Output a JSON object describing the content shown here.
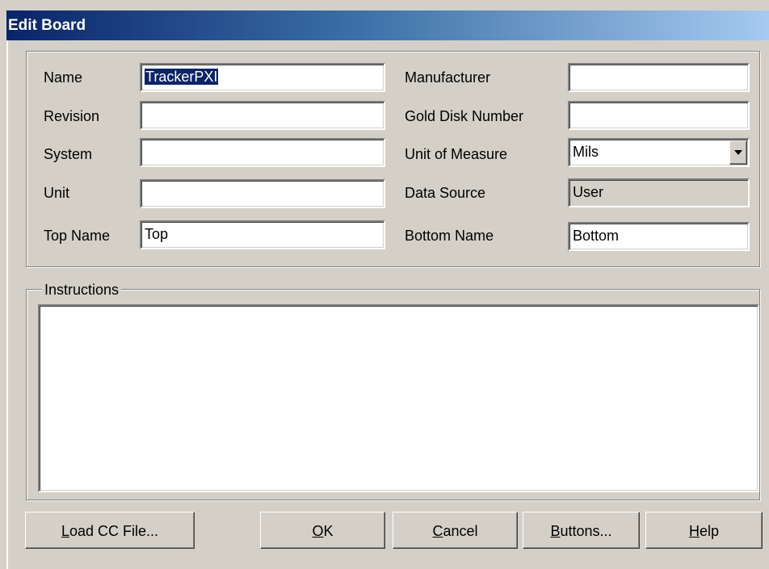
{
  "window": {
    "title": "Edit Board"
  },
  "fields": {
    "name": {
      "label": "Name",
      "value_selected": "TrackerPXI"
    },
    "revision": {
      "label": "Revision",
      "value": ""
    },
    "system": {
      "label": "System",
      "value": ""
    },
    "unit": {
      "label": "Unit",
      "value": ""
    },
    "top_name": {
      "label": "Top Name",
      "value": "Top"
    },
    "manufacturer": {
      "label": "Manufacturer",
      "value": ""
    },
    "gold_disk_number": {
      "label": "Gold Disk Number",
      "value": ""
    },
    "unit_of_measure": {
      "label": "Unit of Measure",
      "value": "Mils"
    },
    "data_source": {
      "label": "Data Source",
      "value": "User"
    },
    "bottom_name": {
      "label": "Bottom Name",
      "value": "Bottom"
    }
  },
  "instructions": {
    "legend": "Instructions",
    "value": ""
  },
  "buttons": {
    "load_cc": {
      "accel": "L",
      "rest": "oad CC File..."
    },
    "ok": {
      "accel": "O",
      "rest": "K"
    },
    "cancel": {
      "accel": "C",
      "rest": "ancel"
    },
    "buttons": {
      "accel": "B",
      "rest": "uttons..."
    },
    "help": {
      "accel": "H",
      "rest": "elp"
    }
  },
  "colors": {
    "titlebar_start": "#0a246a",
    "titlebar_end": "#a6caf0",
    "dialog_face": "#d4d0c8",
    "selection": "#0a246a"
  }
}
